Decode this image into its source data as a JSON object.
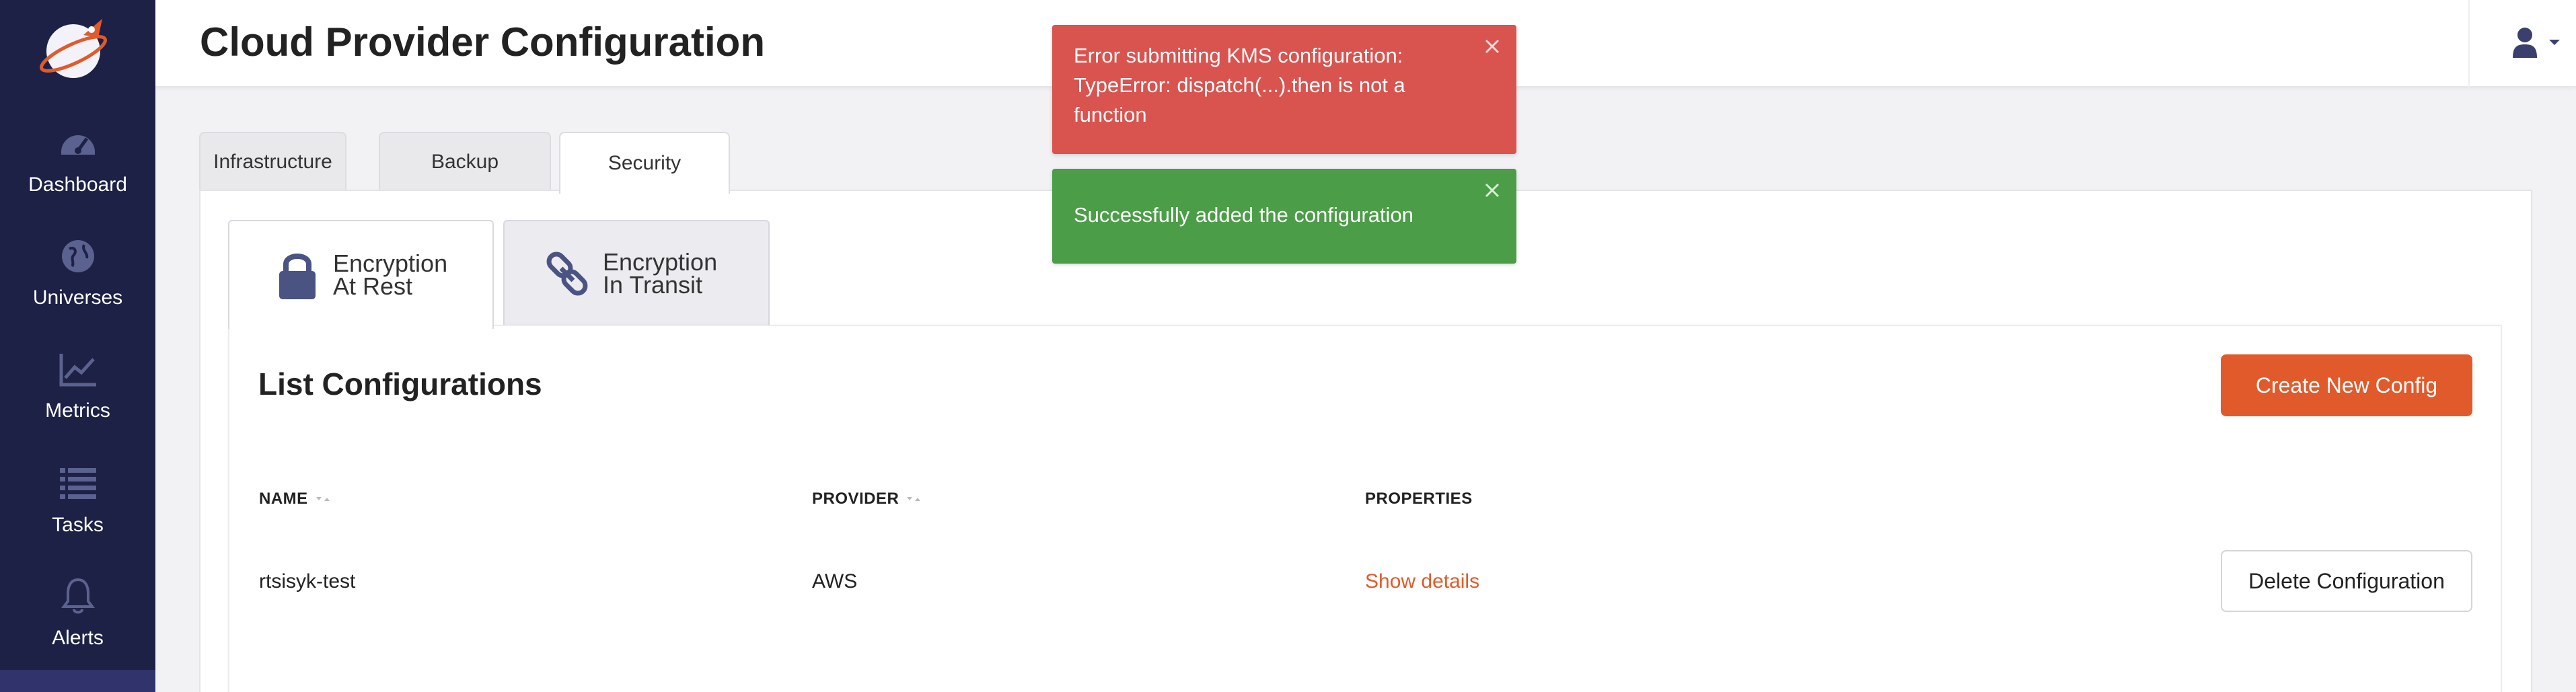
{
  "header": {
    "title": "Cloud Provider Configuration"
  },
  "sidebar": {
    "items": [
      {
        "label": "Dashboard",
        "icon": "dashboard-icon"
      },
      {
        "label": "Universes",
        "icon": "globe-icon"
      },
      {
        "label": "Metrics",
        "icon": "chart-line-icon"
      },
      {
        "label": "Tasks",
        "icon": "list-icon"
      },
      {
        "label": "Alerts",
        "icon": "bell-icon"
      }
    ]
  },
  "top_tabs": [
    {
      "label": "Infrastructure",
      "active": false
    },
    {
      "label": "Backup",
      "active": false
    },
    {
      "label": "Security",
      "active": true
    }
  ],
  "sub_tabs": [
    {
      "label": "Encryption\nAt Rest",
      "icon": "lock-icon",
      "active": true
    },
    {
      "label": "Encryption\nIn Transit",
      "icon": "link-icon",
      "active": false
    }
  ],
  "card": {
    "title": "List Configurations",
    "create_button": "Create New Config",
    "columns": {
      "name": "NAME",
      "provider": "PROVIDER",
      "properties": "PROPERTIES"
    },
    "rows": [
      {
        "name": "rtsisyk-test",
        "provider": "AWS",
        "properties_link": "Show details",
        "action": "Delete Configuration"
      }
    ]
  },
  "toasts": [
    {
      "type": "error",
      "message": "Error submitting KMS configuration: TypeError: dispatch(...).then is not a function"
    },
    {
      "type": "success",
      "message": "Successfully added the configuration"
    }
  ],
  "colors": {
    "sidebar_bg": "#1e2146",
    "accent": "#e05a2b",
    "error": "#d9534f",
    "success": "#4c9d47"
  }
}
